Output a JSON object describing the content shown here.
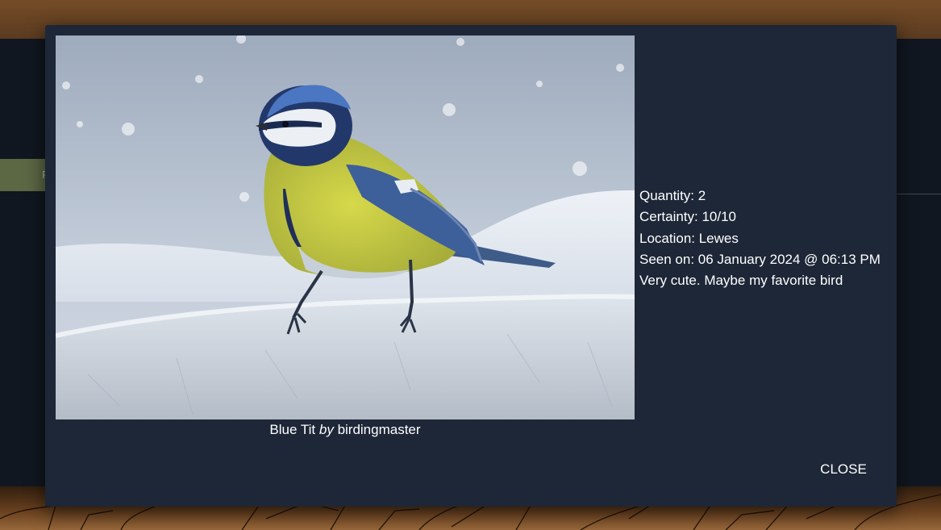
{
  "background": {
    "tab_letter": "F"
  },
  "modal": {
    "photo": {
      "species": "Blue Tit",
      "by_word": "by",
      "author": "birdingmaster"
    },
    "details": {
      "quantity": "Quantity: 2",
      "certainty": "Certainty: 10/10",
      "location": "Location: Lewes",
      "seen_on": "Seen on: 06 January 2024 @ 06:13 PM",
      "notes": "Very cute. Maybe my favorite bird"
    },
    "close_label": "CLOSE"
  },
  "colors": {
    "modal_bg": "#1d2737",
    "text": "#ffffff"
  }
}
